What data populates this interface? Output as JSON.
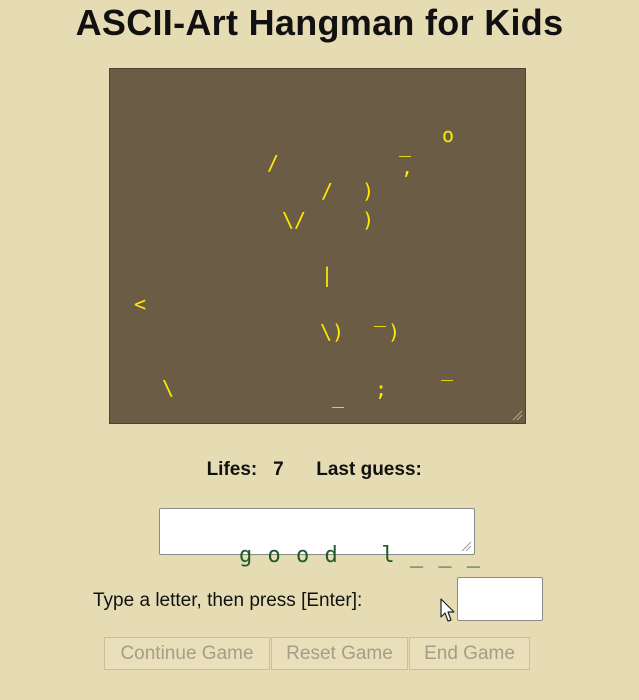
{
  "title": "ASCII-Art Hangman for Kids",
  "art": [
    {
      "ch": "_"
    },
    {
      "ch": "o"
    },
    {
      "ch": "/"
    },
    {
      "ch": ","
    },
    {
      "ch": "/"
    },
    {
      "ch": ")"
    },
    {
      "ch": "\\/"
    },
    {
      "ch": ")"
    },
    {
      "ch": "|"
    },
    {
      "ch": "<"
    },
    {
      "ch": "_"
    },
    {
      "ch": "\\)"
    },
    {
      "ch": ")"
    },
    {
      "ch": "_"
    },
    {
      "ch": "\\"
    },
    {
      "ch": "_"
    },
    {
      "ch": ";"
    }
  ],
  "status": {
    "lifes_label": "Lifes:",
    "lifes_value": "7",
    "last_guess_label": "Last guess:",
    "last_guess_value": ""
  },
  "word_display": "g o o d   l _ _ _",
  "prompt": "Type a letter, then press [Enter]:",
  "input_value": "",
  "buttons": {
    "continue": "Continue Game",
    "reset": "Reset Game",
    "end": "End Game"
  },
  "colors": {
    "background": "#e6dcb4",
    "art_panel": "#6b5c45",
    "art_text": "#ffea00",
    "word_text": "#1e5a2a"
  }
}
